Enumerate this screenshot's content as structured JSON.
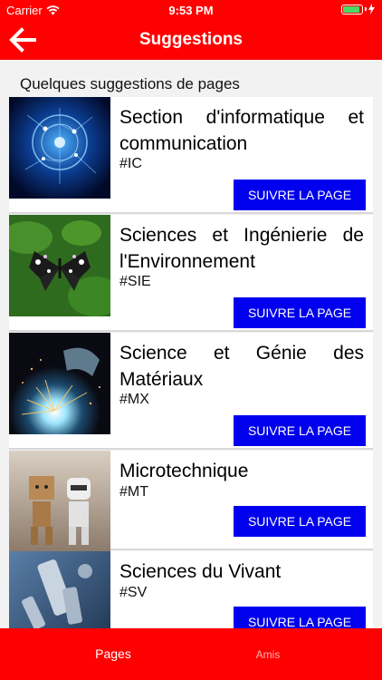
{
  "status_bar": {
    "carrier": "Carrier",
    "time": "9:53 PM",
    "battery_level": 0.9
  },
  "nav": {
    "title": "Suggestions",
    "back_icon": "arrow-left-icon"
  },
  "section_title": "Quelques suggestions de pages",
  "cards": [
    {
      "name": "Section d'informatique et communication",
      "tag": "#IC",
      "button": "SUIVRE LA PAGE",
      "image": "digital-brain-image"
    },
    {
      "name": "Sciences et Ingénierie de l'Environnement",
      "tag": "#SIE",
      "button": "SUIVRE LA PAGE",
      "image": "butterfly-image"
    },
    {
      "name": "Science et Génie des Matériaux",
      "tag": "#MX",
      "button": "SUIVRE LA PAGE",
      "image": "welding-image"
    },
    {
      "name": "Microtechnique",
      "tag": "#MT",
      "button": "SUIVRE LA PAGE",
      "image": "robot-figurines-image"
    },
    {
      "name": "Sciences du Vivant",
      "tag": "#SV",
      "button": "SUIVRE LA PAGE",
      "image": "microscope-image"
    }
  ],
  "tabs": [
    {
      "label": "Pages",
      "active": true
    },
    {
      "label": "Amis",
      "active": false
    }
  ],
  "colors": {
    "primary": "#ff0000",
    "button": "#0000ee",
    "background": "#f2f2f2"
  }
}
